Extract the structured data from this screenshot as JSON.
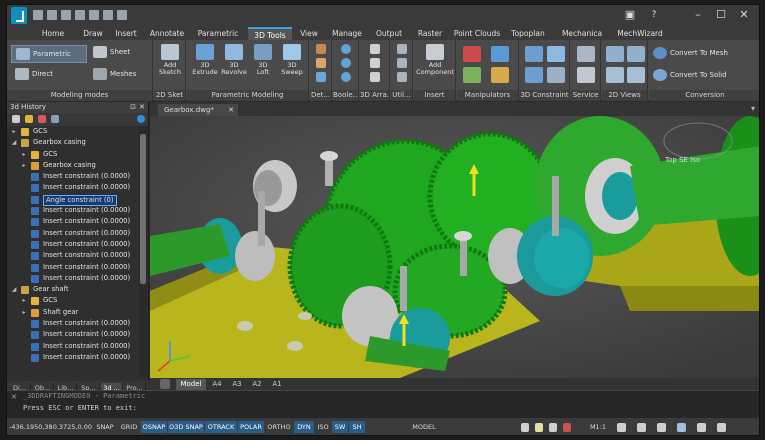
{
  "quick_access": [
    "new-icon",
    "open-icon",
    "save-icon",
    "save-as-icon",
    "undo-icon",
    "redo-icon",
    "print-icon"
  ],
  "tabs": [
    {
      "label": "Home"
    },
    {
      "label": "Draw"
    },
    {
      "label": "Insert"
    },
    {
      "label": "Annotate"
    },
    {
      "label": "Parametric"
    },
    {
      "label": "3D Tools",
      "active": true
    },
    {
      "label": "View"
    },
    {
      "label": "Manage"
    },
    {
      "label": "Output"
    },
    {
      "label": "Raster"
    },
    {
      "label": "Point Clouds"
    },
    {
      "label": "Topoplan"
    },
    {
      "label": "Mechanica"
    },
    {
      "label": "MechWizard"
    }
  ],
  "ribbon": {
    "modeling_modes": {
      "label": "Modeling modes",
      "parametric": "Parametric",
      "direct": "Direct",
      "sheet": "Sheet",
      "meshes": "Meshes"
    },
    "sketch": {
      "label": "2D Sket",
      "add_sketch": [
        "Add",
        "Sketch"
      ]
    },
    "parametric_modeling": {
      "label": "Parametric Modeling",
      "buttons": [
        [
          "3D",
          "Extrude"
        ],
        [
          "3D",
          "Revolve"
        ],
        [
          "3D",
          "Loft"
        ],
        [
          "3D",
          "Sweep"
        ]
      ]
    },
    "det": {
      "label": "Det..."
    },
    "boole": {
      "label": "Boole..."
    },
    "array": {
      "label": "3D Arra..."
    },
    "util": {
      "label": "Util..."
    },
    "insert": {
      "label": "Insert",
      "add_component": [
        "Add",
        "Component"
      ]
    },
    "manipulators": {
      "label": "Manipulators"
    },
    "constraint": {
      "label": "3D Constraint"
    },
    "service": {
      "label": "Service"
    },
    "views": {
      "label": "2D Views"
    },
    "conversion": {
      "label": "Conversion",
      "to_mesh": "Convert To Mesh",
      "to_solid": "Convert To Solid"
    }
  },
  "panel": {
    "title": "3d History",
    "tree": [
      {
        "label": "GCS",
        "level": 1,
        "icon": "folder",
        "arrow": "▸"
      },
      {
        "label": "Gearbox casing",
        "level": 1,
        "icon": "assembly",
        "arrow": "◢"
      },
      {
        "label": "GCS",
        "level": 2,
        "icon": "folder",
        "arrow": "▸"
      },
      {
        "label": "Gearbox casing",
        "level": 2,
        "icon": "part",
        "arrow": "▸"
      },
      {
        "label": "Insert constraint (0.0000)",
        "level": 2,
        "icon": "constraint"
      },
      {
        "label": "Insert constraint (0.0000)",
        "level": 2,
        "icon": "constraint"
      },
      {
        "label": "Angle constraint (0)",
        "level": 2,
        "icon": "constraint",
        "selected": true
      },
      {
        "label": "Insert constraint (0.0000)",
        "level": 2,
        "icon": "constraint"
      },
      {
        "label": "Insert constraint (0.0000)",
        "level": 2,
        "icon": "constraint"
      },
      {
        "label": "Insert constraint (0.0000)",
        "level": 2,
        "icon": "constraint"
      },
      {
        "label": "Insert constraint (0.0000)",
        "level": 2,
        "icon": "constraint"
      },
      {
        "label": "Insert constraint (0.0000)",
        "level": 2,
        "icon": "constraint"
      },
      {
        "label": "Insert constraint (0.0000)",
        "level": 2,
        "icon": "constraint"
      },
      {
        "label": "Insert constraint (0.0000)",
        "level": 2,
        "icon": "constraint"
      },
      {
        "label": "Gear shaft",
        "level": 1,
        "icon": "assembly",
        "arrow": "◢"
      },
      {
        "label": "GCS",
        "level": 2,
        "icon": "folder",
        "arrow": "▸"
      },
      {
        "label": "Shaft gear",
        "level": 2,
        "icon": "part",
        "arrow": "▸"
      },
      {
        "label": "Insert constraint (0.0000)",
        "level": 2,
        "icon": "constraint"
      },
      {
        "label": "Insert constraint (0.0000)",
        "level": 2,
        "icon": "constraint"
      },
      {
        "label": "Insert constraint (0.0000)",
        "level": 2,
        "icon": "constraint"
      },
      {
        "label": "Insert constraint (0.0000)",
        "level": 2,
        "icon": "constraint"
      }
    ],
    "bottom_tabs": [
      {
        "label": "Di..."
      },
      {
        "label": "Ob..."
      },
      {
        "label": "Lib..."
      },
      {
        "label": "Sp..."
      },
      {
        "label": "3d ...",
        "active": true
      },
      {
        "label": "Pro..."
      }
    ]
  },
  "document_tab": "Gearbox.dwg*",
  "viewcube_label": "Top SE Iso",
  "layout_tabs": [
    {
      "label": "Model",
      "active": true
    },
    {
      "label": "A4"
    },
    {
      "label": "A3"
    },
    {
      "label": "A2"
    },
    {
      "label": "A1"
    }
  ],
  "command_lines": [
    "_3DDRAFTINGMODE0 - Parametric",
    "Press ESC or ENTER to exit:"
  ],
  "status": {
    "coords": "-436.1950,380.3725,0.00",
    "toggles": [
      {
        "label": "SNAP",
        "on": false
      },
      {
        "label": "GRID",
        "on": false
      },
      {
        "label": "OSNAP",
        "on": true
      },
      {
        "label": "O3D SNAP",
        "on": true
      },
      {
        "label": "OTRACK",
        "on": true
      },
      {
        "label": "POLAR",
        "on": true
      },
      {
        "label": "ORTHO",
        "on": false
      },
      {
        "label": "DYN",
        "on": true
      },
      {
        "label": "ISO",
        "on": false
      },
      {
        "label": "SW",
        "on": true
      },
      {
        "label": "SH",
        "on": true
      }
    ],
    "model": "MODEL",
    "scale": "M1:1"
  },
  "colors": {
    "accent": "#3aa0e0",
    "gear_green": "#1faa1f",
    "teal": "#1b9c9c",
    "yellow_plate": "#c8c81e",
    "background": "#2b2b2b"
  }
}
